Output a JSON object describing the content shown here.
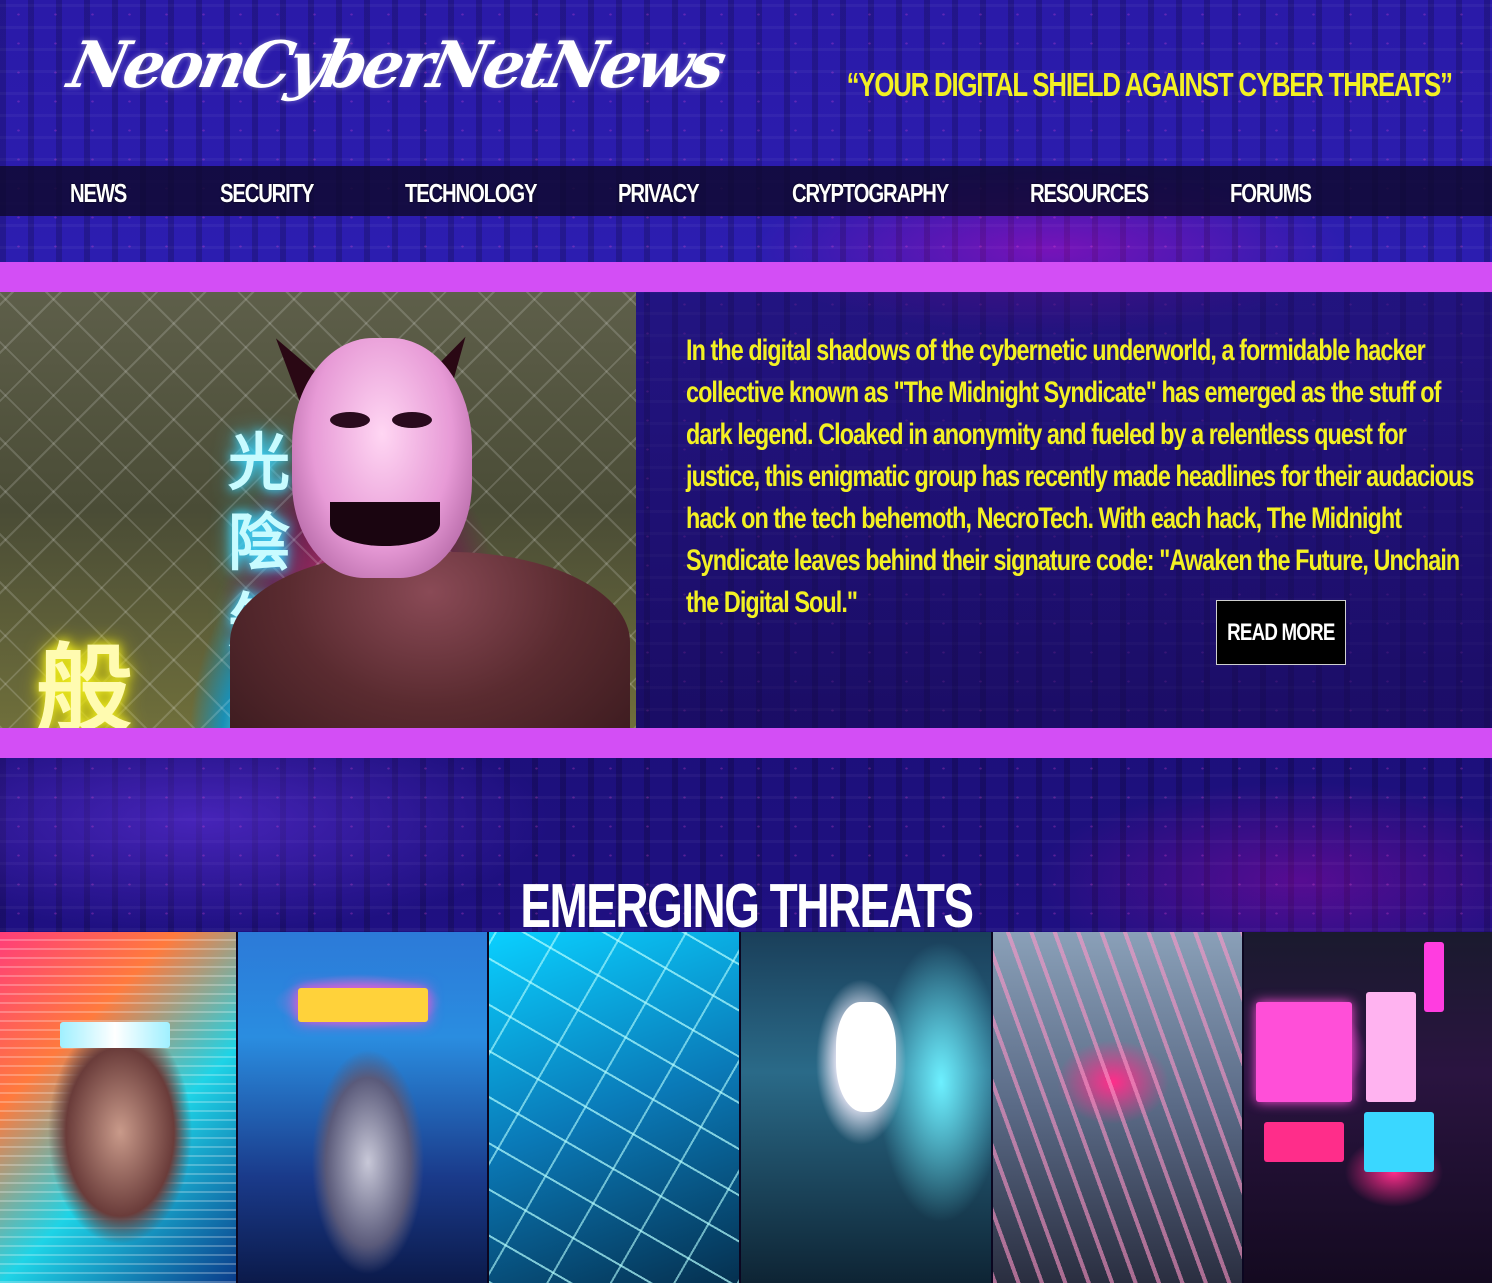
{
  "header": {
    "logo_text": "NeonCyberNetNews",
    "tagline": "“YOUR DIGITAL SHIELD AGAINST CYBER THREATS”"
  },
  "nav": {
    "items": [
      "NEWS",
      "SECURITY",
      "TECHNOLOGY",
      "PRIVACY",
      "CRYPTOGRAPHY",
      "RESOURCES",
      "FORUMS"
    ]
  },
  "feature": {
    "body": "In the digital shadows of the cybernetic underworld, a formidable hacker collective known as \"The Midnight Syndicate\" has emerged as the stuff of dark legend. Cloaked in anonymity and fueled by a relentless quest for justice, this enigmatic group has recently made headlines for their audacious hack on the tech behemoth, NecroTech. With each hack, The Midnight Syndicate leaves behind their signature code: \"Awaken the Future, Unchain the Digital Soul.\"",
    "read_more_label": "READ MORE",
    "image_kanji": [
      "光",
      "陰",
      "矢",
      "般"
    ]
  },
  "section": {
    "title": "EMERGING THREATS"
  },
  "colors": {
    "accent_yellow": "#f3f123",
    "stripe_magenta": "#d34ef5",
    "background_indigo": "#2a1aa8"
  }
}
